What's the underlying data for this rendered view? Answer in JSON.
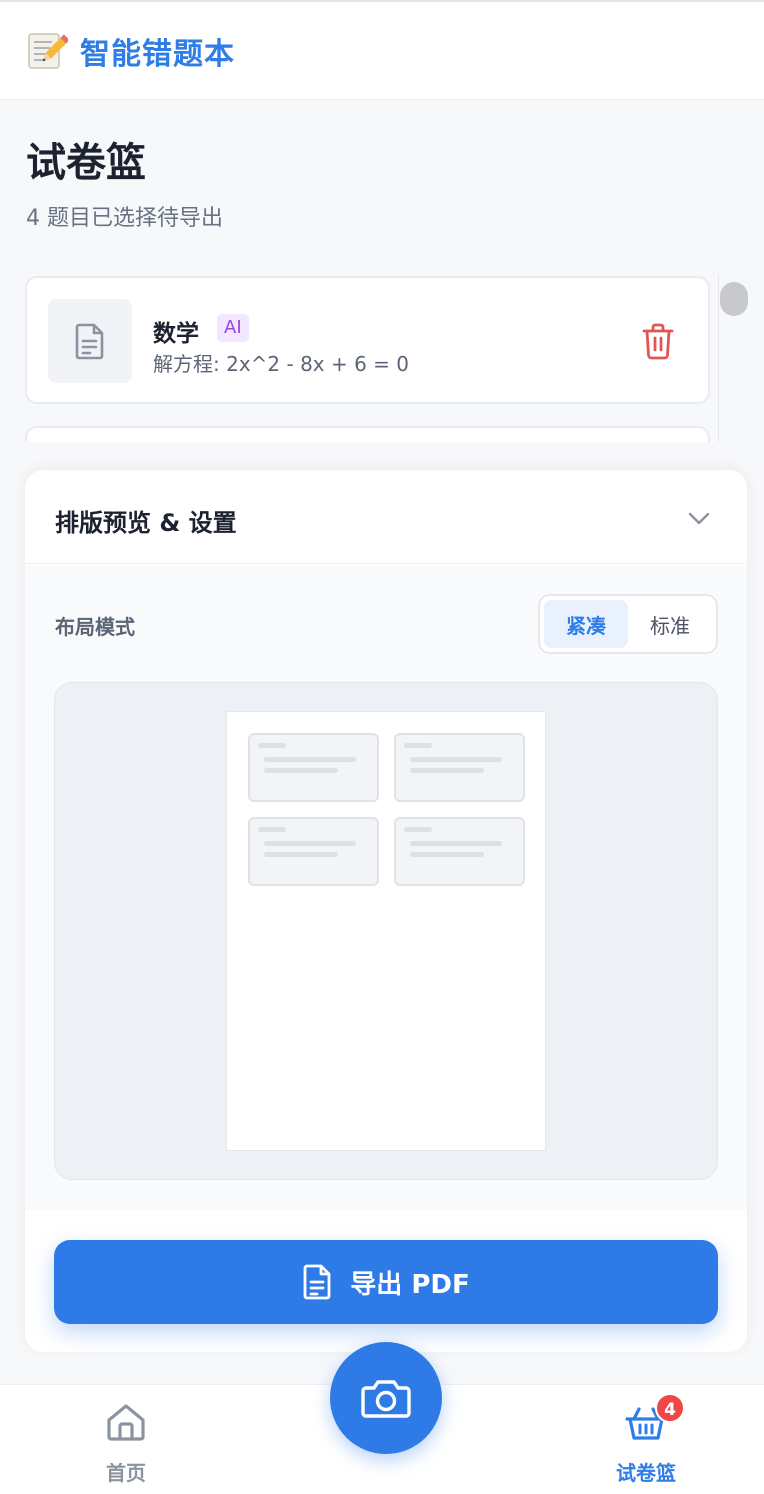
{
  "app": {
    "title": "智能错题本",
    "logo_icon": "memo-pencil-icon"
  },
  "page": {
    "title": "试卷篮",
    "subtitle": "4 题目已选择待导出"
  },
  "questions": [
    {
      "subject": "数学",
      "badge": "AI",
      "text": "解方程: 2x^2 - 8x + 6 = 0",
      "thumb_icon": "document-icon",
      "delete_icon": "trash-icon"
    }
  ],
  "panel": {
    "title": "排版预览 & 设置",
    "toggle_icon": "chevron-down-icon",
    "layout_label": "布局模式",
    "layout_options": [
      "紧凑",
      "标准"
    ],
    "layout_selected": "紧凑",
    "export_label": "导出 PDF",
    "export_icon": "file-text-icon"
  },
  "nav": {
    "home_label": "首页",
    "home_icon": "home-icon",
    "camera_icon": "camera-icon",
    "basket_label": "试卷篮",
    "basket_icon": "basket-icon",
    "basket_count": "4"
  },
  "colors": {
    "accent": "#2e7ae6",
    "badge_bg": "#f1e7fe",
    "badge_text": "#9b45d9",
    "delete": "#e25555",
    "count_badge": "#f04646"
  }
}
